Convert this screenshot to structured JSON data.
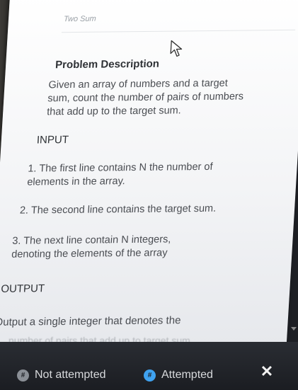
{
  "page": {
    "title": "Two Sum"
  },
  "problem": {
    "heading": "Problem Description",
    "desc_lines": [
      "Given an array of numbers and a target",
      "sum, count the number of pairs of numbers",
      "that add up to the target sum."
    ]
  },
  "input": {
    "heading": "INPUT",
    "item1": [
      "1. The first line contains N the number of",
      "elements in the array."
    ],
    "item2": "2. The second line contains the target sum.",
    "item3": [
      "3. The next line contain N integers,",
      "denoting the elements of the array"
    ]
  },
  "output": {
    "heading": "OUTPUT",
    "line1": "Output a single integer that denotes the",
    "line2_partial": "number of pairs that add up to target sum"
  },
  "status": {
    "not_attempted": {
      "label": "Not attempted",
      "symbol": "#",
      "color": "#8a8f96"
    },
    "attempted": {
      "label": "Attempted",
      "symbol": "#",
      "color": "#3fa2f0"
    },
    "close_symbol": "✕"
  },
  "icons": {
    "cursor": "cursor-arrow-icon",
    "scroll": "scroll-down-icon",
    "close": "close-icon"
  }
}
